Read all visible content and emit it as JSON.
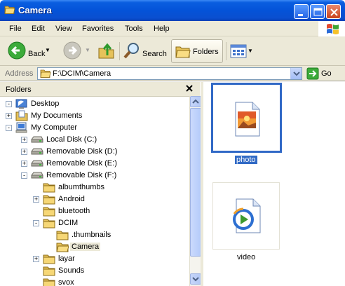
{
  "window": {
    "title": "Camera"
  },
  "menu": [
    "File",
    "Edit",
    "View",
    "Favorites",
    "Tools",
    "Help"
  ],
  "toolbar": {
    "back": "Back",
    "search": "Search",
    "folders": "Folders"
  },
  "address": {
    "label": "Address",
    "path": "F:\\DCIM\\Camera",
    "go": "Go"
  },
  "folders_pane": {
    "title": "Folders",
    "nodes": [
      {
        "label": "Desktop",
        "icon": "desktop-icon",
        "expander": "-"
      },
      {
        "label": "My Documents",
        "icon": "documents-folder-icon",
        "expander": "+"
      },
      {
        "label": "My Computer",
        "icon": "computer-icon",
        "expander": "-"
      },
      {
        "label": "Local Disk (C:)",
        "icon": "drive-icon",
        "expander": "+"
      },
      {
        "label": "Removable Disk (D:)",
        "icon": "drive-icon",
        "expander": "+"
      },
      {
        "label": "Removable Disk (E:)",
        "icon": "drive-icon",
        "expander": "+"
      },
      {
        "label": "Removable Disk (F:)",
        "icon": "drive-icon",
        "expander": "-"
      },
      {
        "label": "albumthumbs",
        "icon": "folder-icon",
        "expander": ""
      },
      {
        "label": "Android",
        "icon": "folder-icon",
        "expander": "+"
      },
      {
        "label": "bluetooth",
        "icon": "folder-icon",
        "expander": ""
      },
      {
        "label": "DCIM",
        "icon": "folder-icon",
        "expander": "-"
      },
      {
        "label": ".thumbnails",
        "icon": "folder-icon",
        "expander": ""
      },
      {
        "label": "Camera",
        "icon": "open-folder-icon",
        "expander": "",
        "selected": true
      },
      {
        "label": "layar",
        "icon": "folder-icon",
        "expander": "+"
      },
      {
        "label": "Sounds",
        "icon": "folder-icon",
        "expander": ""
      },
      {
        "label": "svox",
        "icon": "folder-icon",
        "expander": ""
      }
    ]
  },
  "files": [
    {
      "name": "photo",
      "icon": "image-file-icon",
      "selected": true
    },
    {
      "name": "video",
      "icon": "media-file-icon",
      "selected": false
    }
  ]
}
